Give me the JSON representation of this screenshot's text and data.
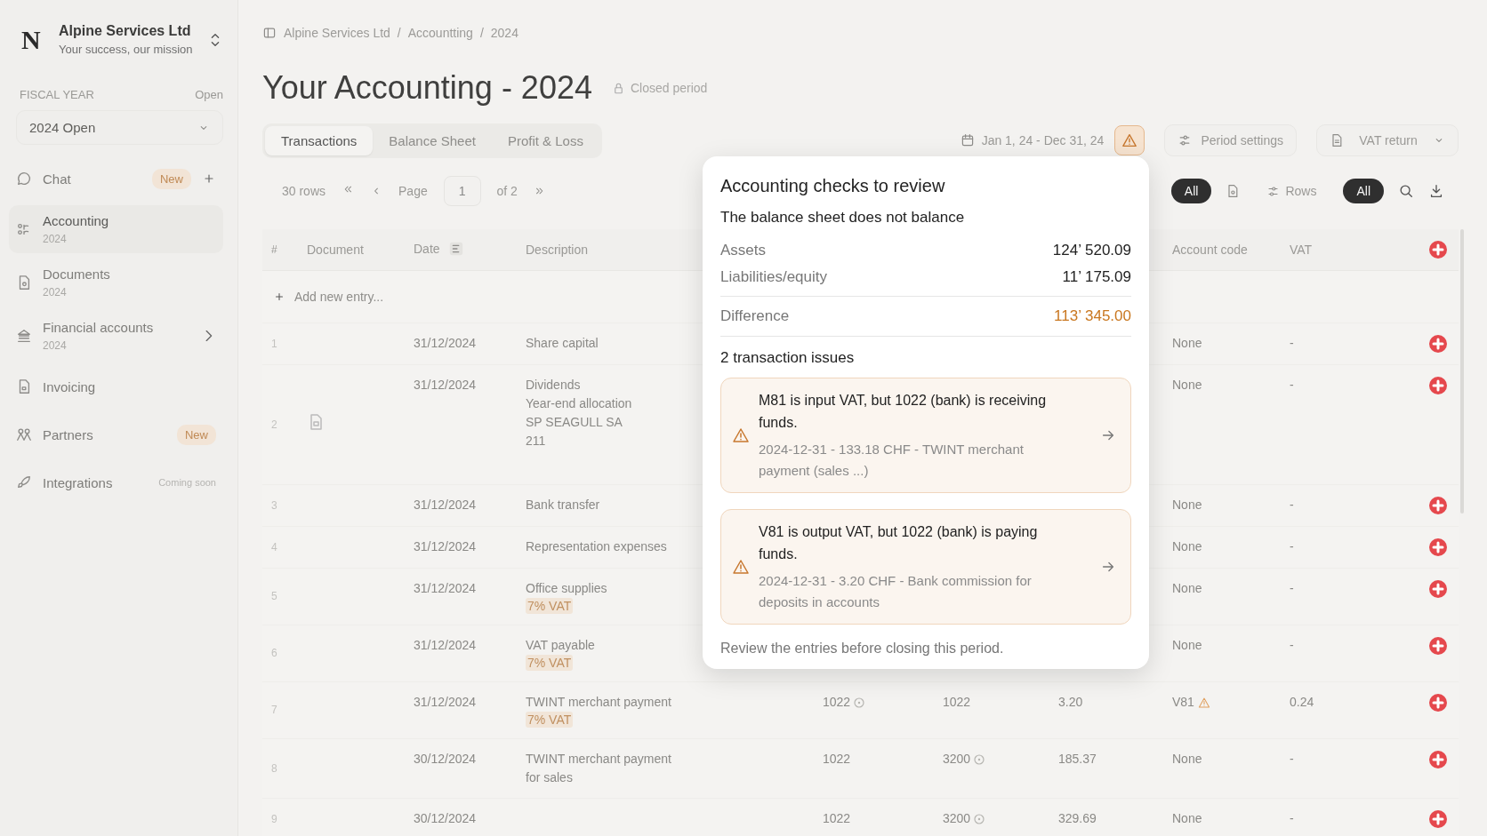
{
  "sidebar": {
    "org": {
      "logo": "N",
      "name": "Alpine Services Ltd",
      "tagline": "Your success, our mission"
    },
    "fiscal_year": {
      "label": "FISCAL YEAR",
      "status": "Open",
      "value": "2024 Open"
    },
    "items": [
      {
        "label": "Chat",
        "badge": "New",
        "kind": "addable",
        "selected": false
      },
      {
        "label": "Accounting",
        "sub": "2024",
        "kind": "link",
        "selected": true
      },
      {
        "label": "Documents",
        "sub": "2024",
        "kind": "link",
        "selected": false
      },
      {
        "label": "Financial accounts",
        "sub": "2024",
        "kind": "expandable",
        "selected": false
      },
      {
        "label": "Invoicing",
        "kind": "link",
        "selected": false
      },
      {
        "label": "Partners",
        "badge": "New",
        "kind": "link",
        "selected": false
      },
      {
        "label": "Integrations",
        "note": "Coming soon",
        "kind": "link",
        "selected": false
      }
    ]
  },
  "breadcrumb": [
    "Alpine Services Ltd",
    "Accountting",
    "2024"
  ],
  "breadcrumb_separator": "/",
  "title": "Your Accounting - 2024",
  "period_status": "Closed period",
  "tabs": [
    {
      "label": "Transactions",
      "selected": true
    },
    {
      "label": "Balance Sheet",
      "selected": false
    },
    {
      "label": "Profit & Loss",
      "selected": false
    }
  ],
  "date_range": "Jan 1, 24 - Dec 31, 24",
  "period_settings": "Period settings",
  "vat_return": "VAT return",
  "pager": {
    "rows": "30 rows",
    "page_label": "Page",
    "page": "1",
    "of": "of 2"
  },
  "filters": {
    "documents": {
      "label": "All",
      "selected": true
    },
    "rows_label": "Rows",
    "rows": {
      "label": "All",
      "selected": true
    }
  },
  "table": {
    "columns": [
      "#",
      "Document",
      "Date",
      "Description",
      "Account code",
      "VAT"
    ],
    "add_entry": "Add new entry...",
    "rows": [
      {
        "number": "1",
        "document": false,
        "date": "31/12/2024",
        "description": [
          {
            "text": "Share capital",
            "kind": "text"
          }
        ],
        "account_code": "None",
        "account_warning": false,
        "vat": "-"
      },
      {
        "number": "2",
        "document": true,
        "date": "31/12/2024",
        "description": [
          {
            "text": "Dividends",
            "kind": "text"
          },
          {
            "text": "Year-end allocation",
            "kind": "text"
          },
          {
            "text": "SP SEAGULL SA",
            "kind": "text"
          },
          {
            "text": "211",
            "kind": "text"
          }
        ],
        "account_code": "None",
        "account_warning": false,
        "vat": "-"
      },
      {
        "number": "3",
        "document": false,
        "date": "31/12/2024",
        "description": [
          {
            "text": "Bank transfer",
            "kind": "text"
          }
        ],
        "account_code": "None",
        "account_warning": false,
        "vat": "-"
      },
      {
        "number": "4",
        "document": false,
        "date": "31/12/2024",
        "description": [
          {
            "text": "Representation expenses",
            "kind": "text"
          }
        ],
        "account_code": "None",
        "account_warning": false,
        "vat": "-"
      },
      {
        "number": "5",
        "document": false,
        "date": "31/12/2024",
        "description": [
          {
            "text": "Office supplies",
            "kind": "text"
          },
          {
            "text": "7% VAT",
            "kind": "tag"
          }
        ],
        "account_code": "None",
        "account_warning": false,
        "vat": "-"
      },
      {
        "number": "6",
        "document": false,
        "date": "31/12/2024",
        "description": [
          {
            "text": "VAT payable",
            "kind": "text"
          },
          {
            "text": "7% VAT",
            "kind": "tag"
          }
        ],
        "account_code": "None",
        "account_warning": false,
        "vat": "-"
      },
      {
        "number": "7",
        "document": false,
        "date": "31/12/2024",
        "description": [
          {
            "text": "TWINT merchant payment",
            "kind": "text"
          },
          {
            "text": "7% VAT",
            "kind": "tag"
          }
        ],
        "column_5": {
          "text": "1022",
          "marked": true
        },
        "column_6": {
          "text": "1022",
          "marked": false
        },
        "column_7": "3.20",
        "account_code": "V81",
        "account_warning": true,
        "vat": "0.24"
      },
      {
        "number": "8",
        "document": false,
        "date": "30/12/2024",
        "description": [
          {
            "text": "TWINT merchant payment",
            "kind": "text"
          },
          {
            "text": "for sales",
            "kind": "text"
          }
        ],
        "column_5": {
          "text": "1022",
          "marked": false
        },
        "column_6": {
          "text": "3200",
          "marked": true
        },
        "column_7": "185.37",
        "account_code": "None",
        "account_warning": false,
        "vat": "-"
      },
      {
        "number": "9",
        "document": false,
        "date": "30/12/2024",
        "description": [],
        "column_5": {
          "text": "1022",
          "marked": false
        },
        "column_6": {
          "text": "3200",
          "marked": true
        },
        "column_7": "329.69",
        "account_code": "None",
        "account_warning": false,
        "vat": "-"
      }
    ]
  },
  "checks": {
    "title": "Accounting checks to review",
    "balance_title": "The balance sheet does not balance",
    "balance": [
      {
        "label": "Assets",
        "value": "124’ 520.09",
        "highlight": false
      },
      {
        "label": "Liabilities/equity",
        "value": "11’ 175.09",
        "highlight": false
      },
      {
        "label": "Difference",
        "value": "113’ 345.00",
        "highlight": true
      }
    ],
    "issues_title": "2 transaction issues",
    "issues": [
      {
        "title": "M81 is input VAT, but 1022 (bank) is receiving funds.",
        "detail": "2024-12-31 - 133.18 CHF - TWINT merchant payment (sales ...)"
      },
      {
        "title": "V81 is output VAT, but 1022 (bank) is paying funds.",
        "detail": "2024-12-31 - 3.20 CHF - Bank commission for deposits in accounts"
      }
    ],
    "footer": "Review the entries before closing this period."
  }
}
